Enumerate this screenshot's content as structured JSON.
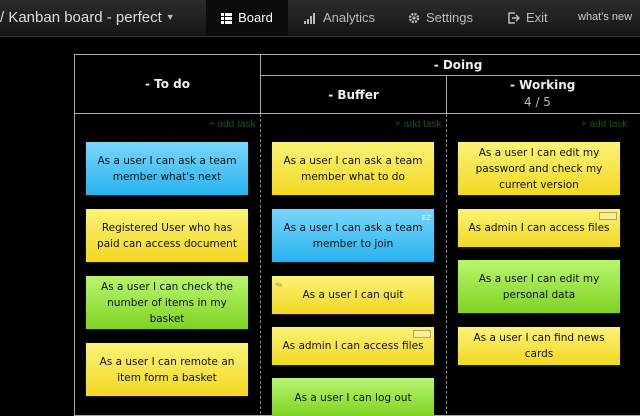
{
  "nav": {
    "brand": "/ Kanban board - perfect",
    "items": [
      {
        "label": "Board",
        "icon": "grid-icon",
        "active": true
      },
      {
        "label": "Analytics",
        "icon": "signal-bars-icon",
        "active": false
      },
      {
        "label": "Settings",
        "icon": "gear-icon",
        "active": false
      },
      {
        "label": "Exit",
        "icon": "exit-icon",
        "active": false
      }
    ],
    "whats_new": "what's new"
  },
  "board": {
    "columns": {
      "todo": "- To do",
      "doing": "- Doing",
      "buffer": "- Buffer",
      "working": "- Working",
      "working_limit": "4 / 5"
    },
    "add_task_label": "+ add task",
    "cards": {
      "todo": [
        {
          "text": "As a user I can ask a team member what's next",
          "color": "blue"
        },
        {
          "text": "Registered User who has paid can access document",
          "color": "yellow"
        },
        {
          "text": "As a user I can check the number of items in my basket",
          "color": "green"
        },
        {
          "text": "As a user I can remote an item form a basket",
          "color": "yellow"
        }
      ],
      "buffer": [
        {
          "text": "As a user I can ask a team member what to do",
          "color": "yellow"
        },
        {
          "text": "As a user I can ask a team member to join",
          "color": "blue",
          "tag": "EZ"
        },
        {
          "text": "As a user I can quit",
          "color": "yellow"
        },
        {
          "text": "As admin I can access files",
          "color": "yellow"
        },
        {
          "text": "As a user I can log out",
          "color": "green"
        }
      ],
      "working": [
        {
          "text": "As a user I can edit my password and check my current version",
          "color": "yellow"
        },
        {
          "text": "As admin I can access files",
          "color": "yellow"
        },
        {
          "text": "As a user I can edit my personal data",
          "color": "green"
        },
        {
          "text": "As a user I can find news cards",
          "color": "yellow"
        }
      ]
    }
  },
  "colors": {
    "card_yellow": "#f2d822",
    "card_blue": "#27b3ee",
    "card_green": "#7ed422",
    "add_task": "#1f4f1f"
  }
}
